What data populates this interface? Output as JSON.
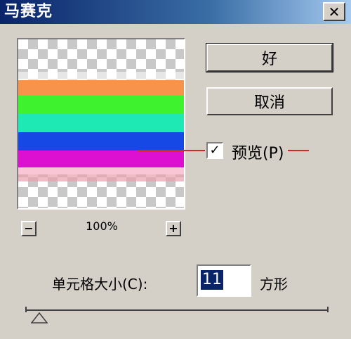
{
  "window": {
    "title": "马赛克",
    "close_glyph": "✕"
  },
  "preview": {
    "stripes": [
      {
        "color": "#ffffff",
        "opacity": 0.55
      },
      {
        "color": "#f7934b",
        "opacity": 1
      },
      {
        "color": "#3ff22e",
        "opacity": 1
      },
      {
        "color": "#1ee8b4",
        "opacity": 1
      },
      {
        "color": "#1648e6",
        "opacity": 1
      },
      {
        "color": "#dd10d2",
        "opacity": 1
      },
      {
        "color": "#f8c6d4",
        "opacity": 1
      },
      {
        "color": "#e8a0ae",
        "opacity": 0.7
      }
    ]
  },
  "zoom": {
    "minus_glyph": "−",
    "plus_glyph": "+",
    "level": "100%"
  },
  "buttons": {
    "ok": "好",
    "cancel": "取消"
  },
  "preview_option": {
    "label": "预览(P)",
    "checked": true,
    "check_glyph": "✓"
  },
  "cell_size": {
    "label": "单元格大小(C):",
    "value": "11",
    "unit": "方形"
  },
  "slider": {
    "thumb_icon": "triangle-up",
    "value": 11
  }
}
